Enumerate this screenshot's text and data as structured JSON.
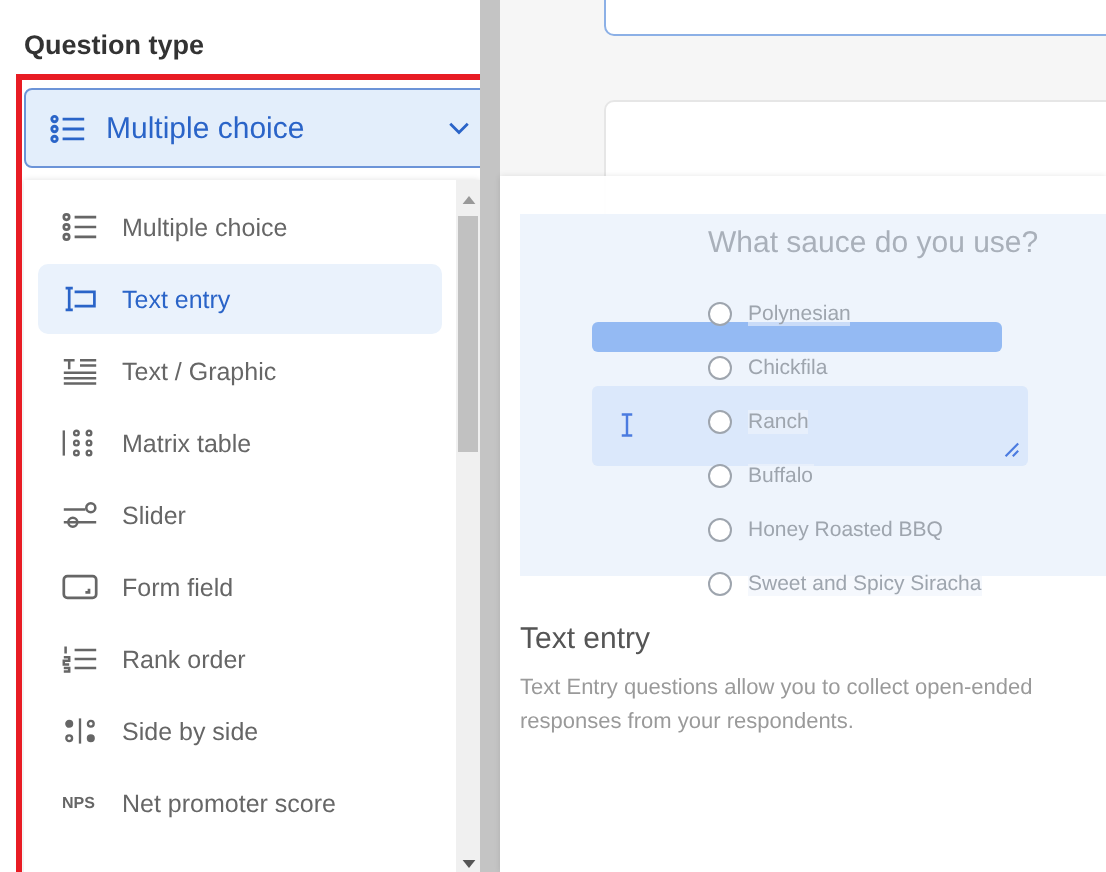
{
  "panel": {
    "title": "Question type",
    "dropdown": {
      "label": "Multiple choice",
      "kind": "multiple-choice",
      "expanded": true
    }
  },
  "menu": {
    "items": [
      {
        "label": "Multiple choice",
        "kind": "multiple-choice",
        "selected": false
      },
      {
        "label": "Text entry",
        "kind": "text-entry",
        "selected": true
      },
      {
        "label": "Text / Graphic",
        "kind": "text-graphic",
        "selected": false
      },
      {
        "label": "Matrix table",
        "kind": "matrix",
        "selected": false
      },
      {
        "label": "Slider",
        "kind": "slider",
        "selected": false
      },
      {
        "label": "Form field",
        "kind": "form-field",
        "selected": false
      },
      {
        "label": "Rank order",
        "kind": "rank-order",
        "selected": false
      },
      {
        "label": "Side by side",
        "kind": "side-by-side",
        "selected": false
      },
      {
        "label": "Net promoter score",
        "kind": "text",
        "icon_text": "NPS",
        "selected": false
      }
    ]
  },
  "preview": {
    "question": "What sauce do you use?",
    "options": [
      {
        "label": "Polynesian",
        "selected": false
      },
      {
        "label": "Chickfila",
        "selected": false
      },
      {
        "label": "Ranch",
        "selected": false
      },
      {
        "label": "Buffalo",
        "selected": false
      },
      {
        "label": "Honey Roasted BBQ",
        "selected": false
      },
      {
        "label": "Sweet and Spicy Siracha",
        "selected": false
      }
    ],
    "title": "Text entry",
    "description": "Text Entry questions allow you to collect open-ended responses from your respondents."
  }
}
